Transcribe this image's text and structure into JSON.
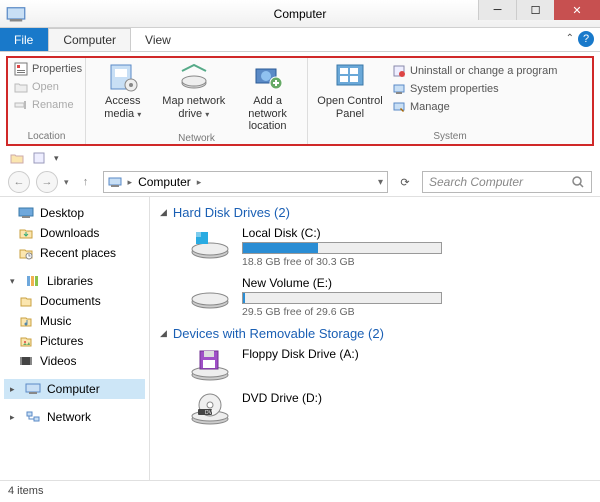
{
  "window": {
    "title": "Computer"
  },
  "menu": {
    "file": "File",
    "computer": "Computer",
    "view": "View"
  },
  "ribbon": {
    "location": {
      "label": "Location",
      "properties": "Properties",
      "open": "Open",
      "rename": "Rename"
    },
    "network": {
      "label": "Network",
      "access_media": "Access media",
      "map_drive": "Map network drive",
      "add_location": "Add a network location"
    },
    "system_btn": "Open Control Panel",
    "system": {
      "label": "System",
      "uninstall": "Uninstall or change a program",
      "props": "System properties",
      "manage": "Manage"
    }
  },
  "address": {
    "root": "Computer",
    "search_placeholder": "Search Computer"
  },
  "sidebar": {
    "desktop": "Desktop",
    "downloads": "Downloads",
    "recent": "Recent places",
    "libraries": "Libraries",
    "documents": "Documents",
    "music": "Music",
    "pictures": "Pictures",
    "videos": "Videos",
    "computer": "Computer",
    "network": "Network"
  },
  "content": {
    "hdd_header": "Hard Disk Drives (2)",
    "removable_header": "Devices with Removable Storage (2)",
    "drives": [
      {
        "name": "Local Disk (C:)",
        "free_text": "18.8 GB free of 30.3 GB",
        "used_pct": 38
      },
      {
        "name": "New Volume (E:)",
        "free_text": "29.5 GB free of 29.6 GB",
        "used_pct": 0
      }
    ],
    "removable": [
      {
        "name": "Floppy Disk Drive (A:)"
      },
      {
        "name": "DVD Drive (D:)"
      }
    ]
  },
  "status": {
    "items": "4 items"
  }
}
